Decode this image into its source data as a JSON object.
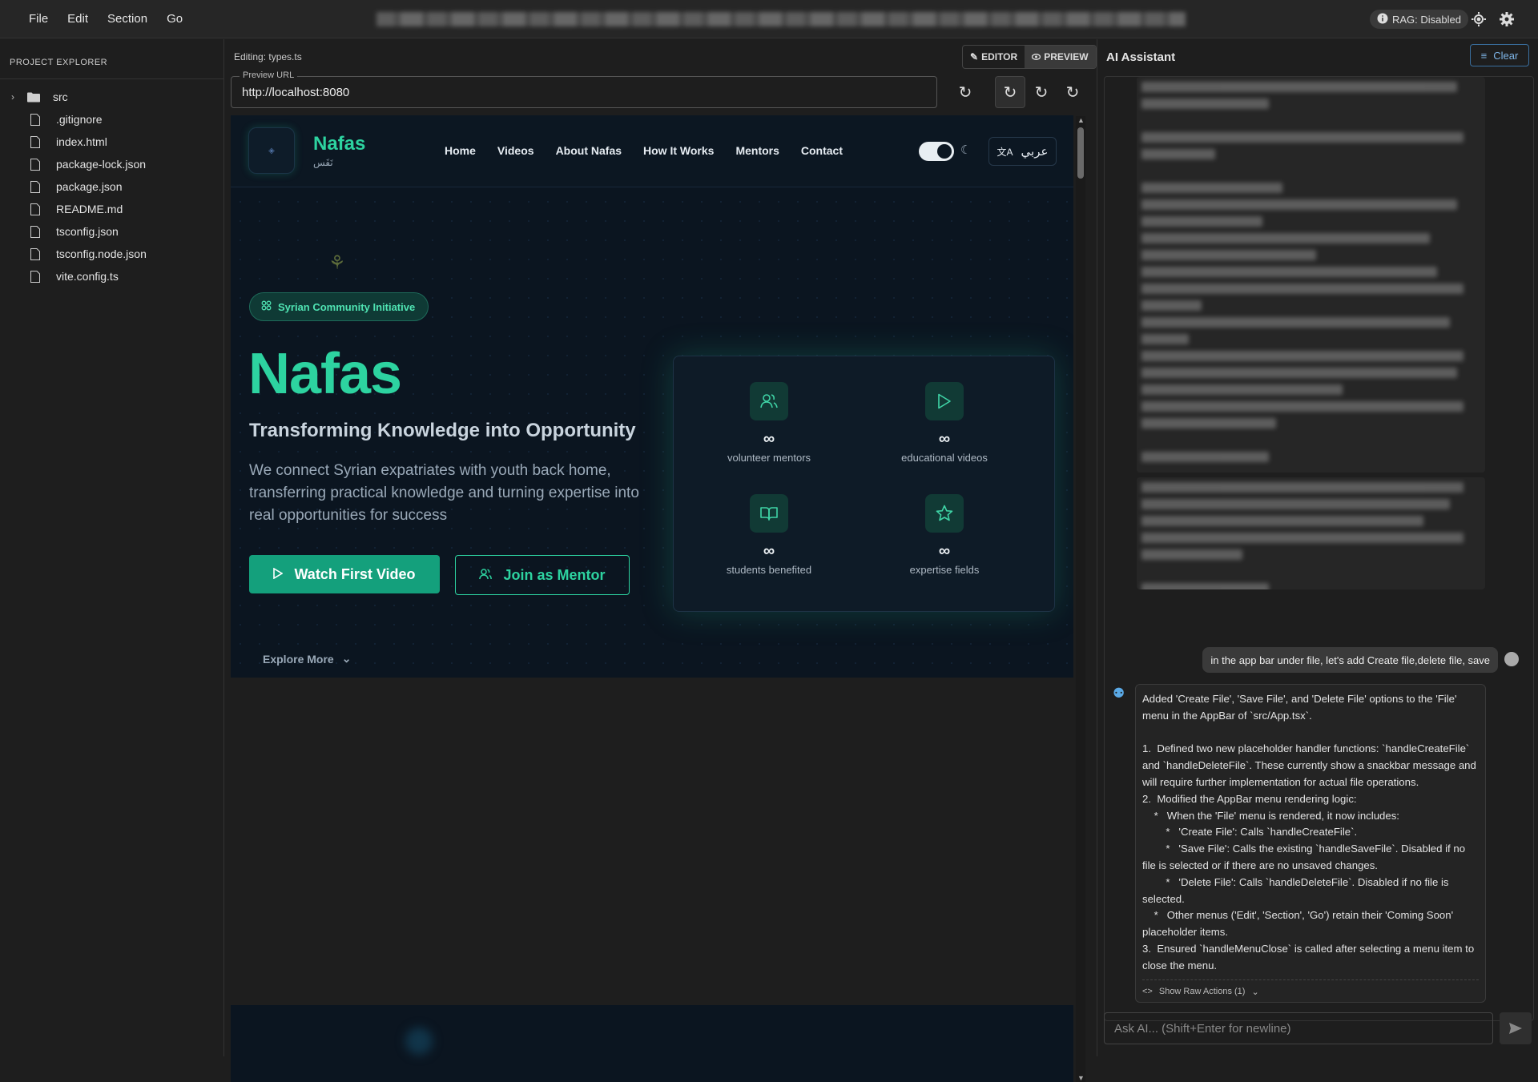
{
  "menu": [
    "File",
    "Edit",
    "Section",
    "Go"
  ],
  "topbar": {
    "rag_label": "RAG: Disabled"
  },
  "explorer": {
    "title": "PROJECT EXPLORER",
    "folders": [
      {
        "name": "src"
      }
    ],
    "files": [
      ".gitignore",
      "index.html",
      "package-lock.json",
      "package.json",
      "README.md",
      "tsconfig.json",
      "tsconfig.node.json",
      "vite.config.ts"
    ]
  },
  "editor": {
    "editing_label": "Editing: types.ts",
    "editor_tab": "EDITOR",
    "preview_tab": "PREVIEW",
    "url_legend": "Preview URL",
    "url_value": "http://localhost:8080"
  },
  "site": {
    "brand_name": "Nafas",
    "brand_sub": "نَفَس",
    "nav": [
      "Home",
      "Videos",
      "About Nafas",
      "How It Works",
      "Mentors",
      "Contact"
    ],
    "lang_label": "عربي",
    "badge": "Syrian Community Initiative",
    "hero_title": "Nafas",
    "hero_sub": "Transforming Knowledge into Opportunity",
    "hero_desc": "We connect Syrian expatriates with youth back home, transferring practical knowledge and turning expertise into real opportunities for success",
    "btn_primary": "Watch First Video",
    "btn_outline": "Join as Mentor",
    "explore": "Explore More",
    "stats": [
      {
        "value": "∞",
        "label": "volunteer mentors",
        "icon": "users-icon"
      },
      {
        "value": "∞",
        "label": "educational videos",
        "icon": "play-icon"
      },
      {
        "value": "∞",
        "label": "students benefited",
        "icon": "book-icon"
      },
      {
        "value": "∞",
        "label": "expertise fields",
        "icon": "star-icon"
      }
    ]
  },
  "assistant": {
    "title": "AI Assistant",
    "clear_label": "Clear",
    "user_message": "in the app bar under file, let's add Create file,delete file, save",
    "bot_message": "Added 'Create File', 'Save File', and 'Delete File' options to the 'File' menu in the AppBar of `src/App.tsx`.\n\n1.  Defined two new placeholder handler functions: `handleCreateFile` and `handleDeleteFile`. These currently show a snackbar message and will require further implementation for actual file operations.\n2.  Modified the AppBar menu rendering logic:\n    *   When the 'File' menu is rendered, it now includes:\n        *   'Create File': Calls `handleCreateFile`.\n        *   'Save File': Calls the existing `handleSaveFile`. Disabled if no file is selected or if there are no unsaved changes.\n        *   'Delete File': Calls `handleDeleteFile`. Disabled if no file is selected.\n    *   Other menus ('Edit', 'Section', 'Go') retain their 'Coming Soon' placeholder items.\n3.  Ensured `handleMenuClose` is called after selecting a menu item to close the menu.",
    "raw_actions": "Show Raw Actions (1)",
    "input_placeholder": "Ask AI... (Shift+Enter for newline)"
  }
}
